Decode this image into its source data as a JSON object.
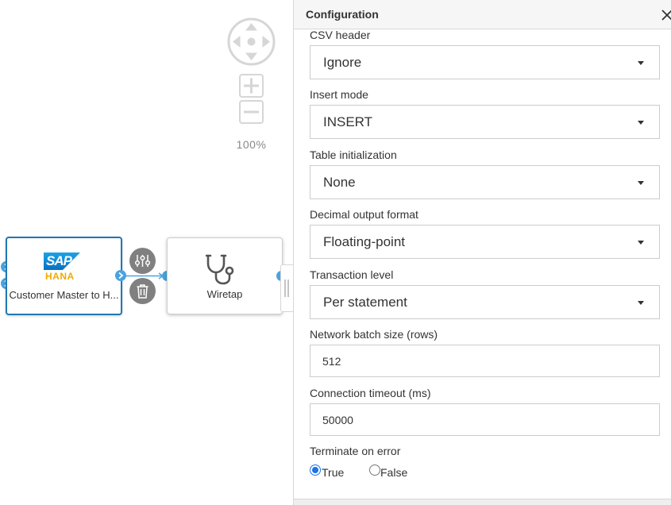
{
  "canvas": {
    "zoom_level": "100%",
    "nodes": {
      "hana": {
        "label": "Customer Master to H...",
        "logo_top": "SAP",
        "logo_bottom": "HANA"
      },
      "wiretap": {
        "label": "Wiretap"
      }
    }
  },
  "panel": {
    "title": "Configuration",
    "fields": {
      "csv_header": {
        "label": "CSV header",
        "value": "Ignore"
      },
      "insert_mode": {
        "label": "Insert mode",
        "value": "INSERT"
      },
      "table_init": {
        "label": "Table initialization",
        "value": "None"
      },
      "decimal_format": {
        "label": "Decimal output format",
        "value": "Floating-point"
      },
      "transaction_level": {
        "label": "Transaction level",
        "value": "Per statement"
      },
      "batch_size": {
        "label": "Network batch size (rows)",
        "value": "512"
      },
      "conn_timeout": {
        "label": "Connection timeout (ms)",
        "value": "50000"
      },
      "terminate_on_error": {
        "label": "Terminate on error",
        "options": [
          "True",
          "False"
        ],
        "selected": "True"
      }
    }
  },
  "colors": {
    "accent": "#1f78b4",
    "port": "#4aa3df",
    "sap_blue": "#1b90d6",
    "hana_gold": "#f0ab00",
    "action_button": "#808080",
    "radio_selected": "#1a73e8"
  },
  "icons": [
    "navigation-pad-icon",
    "zoom-in-icon",
    "zoom-out-icon",
    "sap-hana-logo",
    "stethoscope-icon",
    "settings-sliders-icon",
    "trash-icon",
    "chevron-right-icon",
    "close-icon",
    "dropdown-caret-icon"
  ]
}
